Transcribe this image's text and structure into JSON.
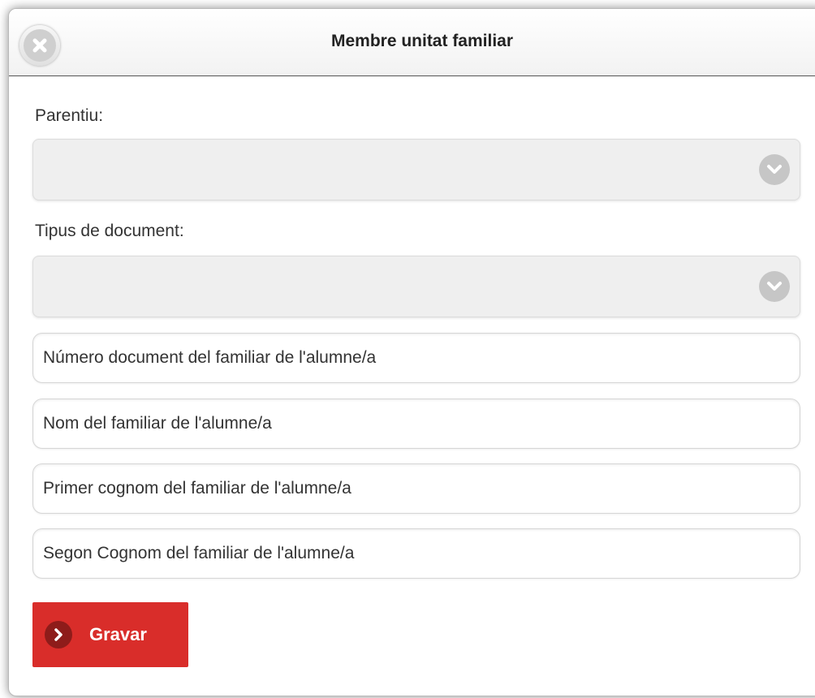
{
  "dialog": {
    "title": "Membre unitat familiar",
    "close_icon": "close-icon"
  },
  "form": {
    "parentiu": {
      "label": "Parentiu:",
      "value": "",
      "icon": "chevron-down-icon"
    },
    "tipus_document": {
      "label": "Tipus de document:",
      "value": "",
      "icon": "chevron-down-icon"
    },
    "numero_document": {
      "placeholder": "Número document del familiar de l'alumne/a"
    },
    "nom": {
      "placeholder": "Nom del familiar de l'alumne/a"
    },
    "primer_cognom": {
      "placeholder": "Primer cognom del familiar de l'alumne/a"
    },
    "segon_cognom": {
      "placeholder": "Segon Cognom del familiar de l'alumne/a"
    }
  },
  "actions": {
    "save_label": "Gravar",
    "save_icon": "chevron-right-icon",
    "save_color": "#d92d2a"
  }
}
